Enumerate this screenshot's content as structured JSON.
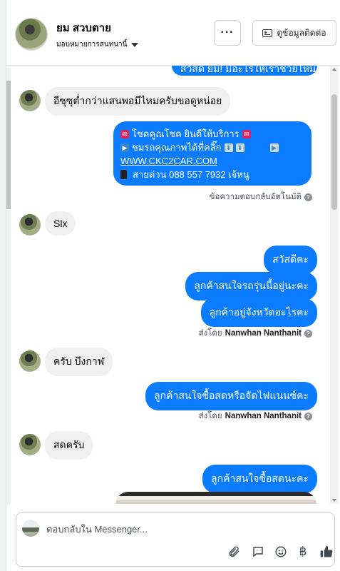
{
  "header": {
    "contact_name": "ยม สวบตาย",
    "assign_label": "มอบหมายการสนทนานี้",
    "more_label": "···",
    "contact_info_label": "ดูข้อมูลติดต่อ"
  },
  "thread": {
    "top_partial_text": "สวัสดี ยม! มีอะไรให้เราช่วยไหม",
    "msg1": "อีซุซุต่ำกว่าแสนพอมีไหมครับขอดูหน่อย",
    "auto_reply": {
      "line1": "โชคคูณโชค ยินดีให้บริการ",
      "line2": "ชมรถคุณภาพได้ที่คลิ๊ก",
      "line3": "WWW.CKC2CAR.COM",
      "line4": "สายด่วน 088 557 7932 เจ้หนู"
    },
    "auto_reply_meta": "ข้อความตอบกลับอัตโนมัติ",
    "msg2": "Slx",
    "out1": "สวัสดีคะ",
    "out2": "ลูกค้าสนใจรถรุ่นนี้อยู่นะคะ",
    "out3": "ลูกค้าอยู่จังหวัดอะไรคะ",
    "sent_by_label": "ส่งโดย",
    "sender_name": "Nanwhan Nanthanit",
    "msg3": "ครับ  บึงกาฬ",
    "out4": "ลูกค้าสนใจซื้อสดหรือจัดไฟแนนซ์คะ",
    "msg4": "สดครับ",
    "out5": "ลูกค้าสนใจซื้อสดนะคะ"
  },
  "composer": {
    "placeholder": "ตอบกลับใน Messenger..."
  },
  "icons": [
    "more-icon",
    "contact-card-icon",
    "caret-down-icon",
    "attachment-icon",
    "saved-reply-icon",
    "emoji-icon",
    "baht-icon",
    "like-icon",
    "info-icon"
  ],
  "colors": {
    "outgoing_bubble": "#0b7cff",
    "incoming_bubble": "#f0f0f0"
  }
}
